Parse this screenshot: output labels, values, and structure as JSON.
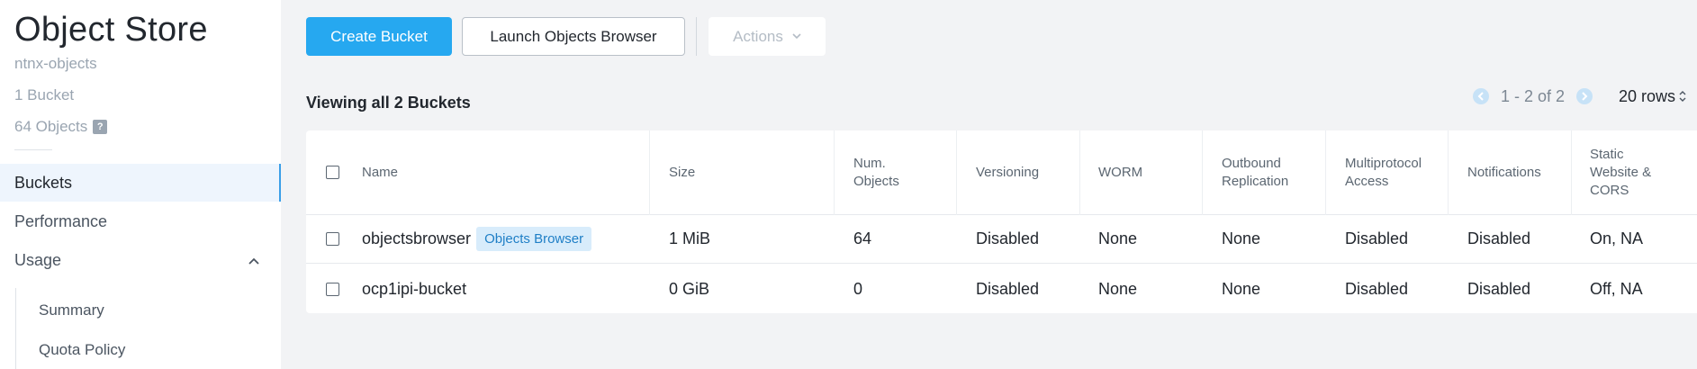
{
  "sidebar": {
    "title": "Object Store",
    "store_name": "ntnx-objects",
    "bucket_count": "1 Bucket",
    "object_count": "64 Objects",
    "help_glyph": "?",
    "nav": {
      "buckets": "Buckets",
      "performance": "Performance",
      "usage": "Usage",
      "summary": "Summary",
      "quota_policy": "Quota Policy"
    }
  },
  "toolbar": {
    "create_bucket": "Create Bucket",
    "launch_browser": "Launch Objects Browser",
    "actions": "Actions"
  },
  "listing": {
    "viewing_label": "Viewing all 2 Buckets",
    "pager_range": "1 - 2 of 2",
    "rows_per_page": "20 rows"
  },
  "table": {
    "columns": {
      "name": "Name",
      "size": "Size",
      "num_objects": "Num. Objects",
      "versioning": "Versioning",
      "worm": "WORM",
      "outbound_replication": "Outbound Replication",
      "multiprotocol_access": "Multiprotocol Access",
      "notifications": "Notifications",
      "static_website": "Static Website & CORS"
    },
    "rows": [
      {
        "name": "objectsbrowser",
        "tag": "Objects Browser",
        "size": "1 MiB",
        "num_objects": "64",
        "versioning": "Disabled",
        "worm": "None",
        "outbound_replication": "None",
        "multiprotocol_access": "Disabled",
        "notifications": "Disabled",
        "static_website": "On, NA"
      },
      {
        "name": "ocp1ipi-bucket",
        "size": "0 GiB",
        "num_objects": "0",
        "versioning": "Disabled",
        "worm": "None",
        "outbound_replication": "None",
        "multiprotocol_access": "Disabled",
        "notifications": "Disabled",
        "static_website": "Off, NA"
      }
    ]
  },
  "colors": {
    "primary": "#26a8f0",
    "active_nav_bg": "#eef5fd",
    "tag_bg": "#d8ecfb",
    "tag_text": "#1f7fc6"
  }
}
